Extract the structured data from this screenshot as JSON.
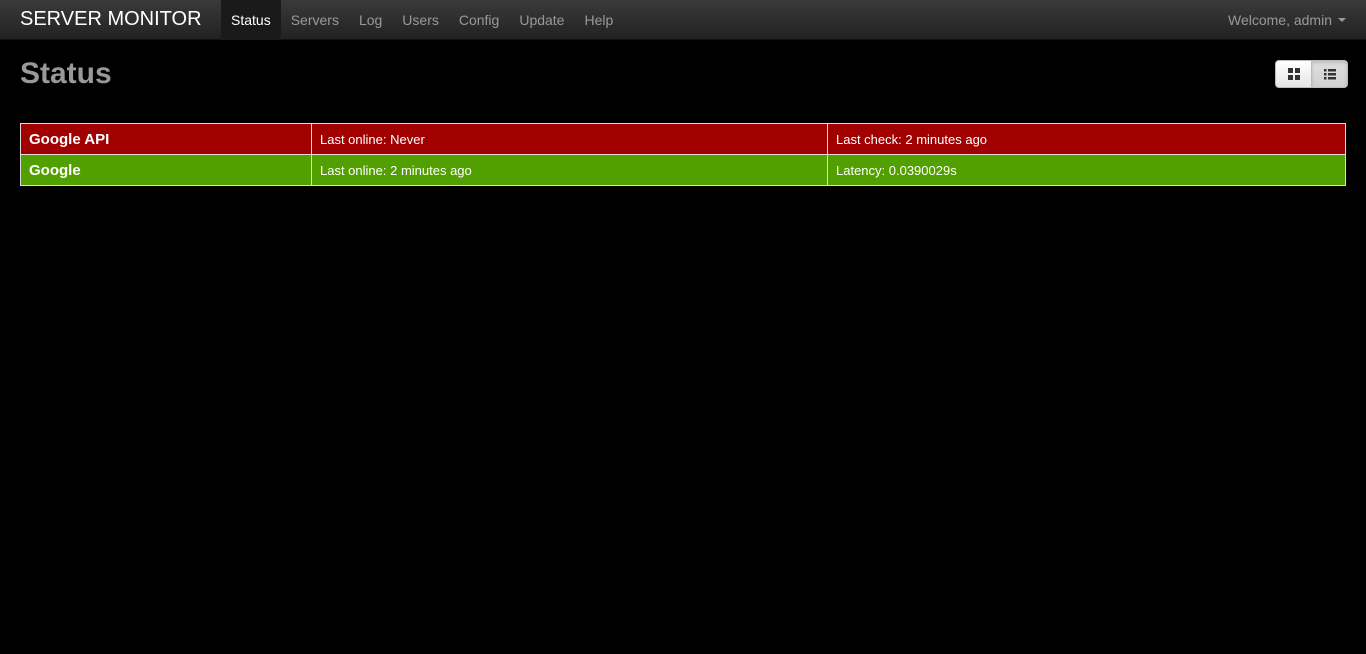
{
  "navbar": {
    "brand": "SERVER MONITOR",
    "items": [
      {
        "label": "Status",
        "active": true
      },
      {
        "label": "Servers"
      },
      {
        "label": "Log"
      },
      {
        "label": "Users"
      },
      {
        "label": "Config"
      },
      {
        "label": "Update"
      },
      {
        "label": "Help"
      }
    ],
    "user_label": "Welcome, admin"
  },
  "page": {
    "title": "Status"
  },
  "view_toggle": {
    "options": [
      "grid-icon",
      "list-icon"
    ],
    "selected": "list-icon"
  },
  "colors": {
    "offline": "#a00000",
    "online": "#52a000"
  },
  "servers": [
    {
      "name": "Google API",
      "status": "offline",
      "online_text": "Last online: Never",
      "detail_text": "Last check: 2 minutes ago"
    },
    {
      "name": "Google",
      "status": "online",
      "online_text": "Last online: 2 minutes ago",
      "detail_text": "Latency: 0.0390029s"
    }
  ]
}
